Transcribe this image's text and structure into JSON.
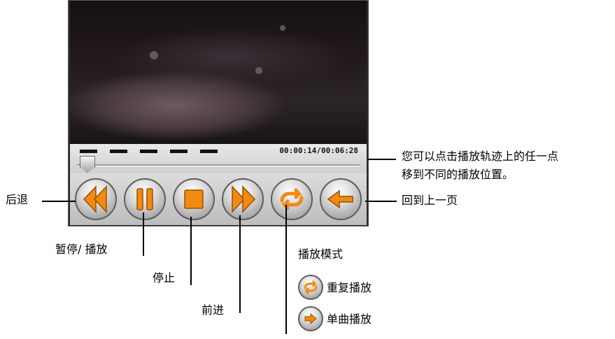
{
  "player": {
    "time_display": "00:00:14/00:06:28",
    "progress_fraction": 0.036
  },
  "labels": {
    "rewind": "后退",
    "pause_play": "暂停/ 播放",
    "stop": "停止",
    "forward": "前进",
    "back_page": "回到上一页",
    "seek_hint_line1": "您可以点击播放轨迹上的任一点",
    "seek_hint_line2": "移到不同的播放位置。",
    "play_mode_title": "播放模式",
    "repeat_mode": "重复播放",
    "single_mode": "单曲播放"
  },
  "colors": {
    "icon_orange": "#f28a10",
    "button_gray": "#bcbcbc",
    "text": "#000000"
  },
  "icons": [
    "rewind-icon",
    "pause-icon",
    "stop-icon",
    "forward-icon",
    "repeat-icon",
    "back-icon",
    "single-play-icon"
  ]
}
